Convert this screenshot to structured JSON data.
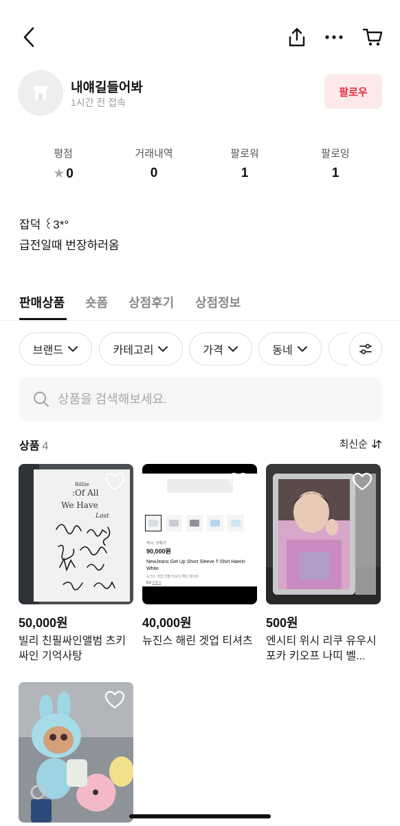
{
  "header": {
    "back_icon": "chevron-left-icon",
    "share_icon": "share-icon",
    "more_icon": "more-horizontal-icon",
    "cart_icon": "cart-icon"
  },
  "profile": {
    "store_name": "내얘길들어봐",
    "last_seen": "1시간 전 접속",
    "follow_label": "팔로우",
    "avatar_icon": "store-icon"
  },
  "stats": [
    {
      "label": "평점",
      "value": "0"
    },
    {
      "label": "거래내역",
      "value": "0"
    },
    {
      "label": "팔로워",
      "value": "1"
    },
    {
      "label": "팔로잉",
      "value": "1"
    }
  ],
  "bio": {
    "line1": "잡덕 ꒰3*°",
    "line2": "급전일때 번장하러옴"
  },
  "tabs": [
    {
      "label": "판매상품",
      "active": true
    },
    {
      "label": "숏폼",
      "active": false
    },
    {
      "label": "상점후기",
      "active": false
    },
    {
      "label": "상점정보",
      "active": false
    }
  ],
  "filters": [
    {
      "label": "브랜드"
    },
    {
      "label": "카테고리"
    },
    {
      "label": "가격"
    },
    {
      "label": "동네"
    }
  ],
  "search": {
    "placeholder": "상품을 검색해보세요."
  },
  "list": {
    "title": "상품",
    "count": "4",
    "sort_label": "최신순"
  },
  "products": [
    {
      "price": "50,000원",
      "name": "빌리 친필싸인앨범 츠키싸인 기억사탕"
    },
    {
      "price": "40,000원",
      "name": "뉴진스 해린 겟업 티셔츠"
    },
    {
      "price": "500원",
      "name": "엔시티 위시 리쿠 유우시 포카 키오프 나띠 벨..."
    },
    {
      "price": "",
      "name": ""
    }
  ],
  "product2_thumb": {
    "label_small": "즉시 구매가",
    "price": "90,000원",
    "title": "NewJeans Get Up Short Sleeve T-Shirt Haerin White",
    "sub": "뉴진스 겟업 반팔 티셔츠 해린 화이트",
    "rating": "5.0",
    "review": "리뷰 8"
  },
  "album_text": {
    "brand": "Billlie",
    "title1": ":Of All",
    "title2": "We Have",
    "title3": "Lost"
  },
  "colors": {
    "follow_bg": "#fde8ea",
    "follow_text": "#e8313f"
  }
}
